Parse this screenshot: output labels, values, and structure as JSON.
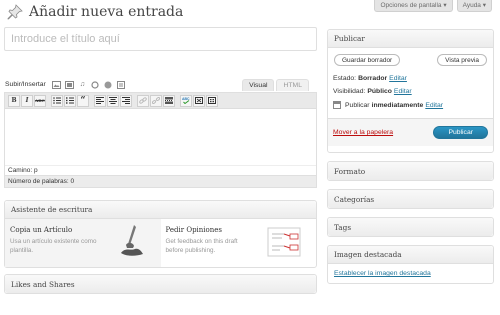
{
  "screen_tabs": {
    "options": "Opciones de pantalla ▾",
    "help": "Ayuda ▾"
  },
  "header": {
    "title": "Añadir nueva entrada"
  },
  "title_field": {
    "placeholder": "Introduce el título aquí"
  },
  "media": {
    "label": "Subir/Insertar"
  },
  "editor_tabs": {
    "visual": "Visual",
    "html": "HTML"
  },
  "toolbar": {
    "bold": "B",
    "italic": "I",
    "strike": "ABC",
    "quote": "“"
  },
  "editor": {
    "path": "Camino: p",
    "word_count": "Número de palabras: 0"
  },
  "writing_helper": {
    "title": "Asistente de escritura",
    "items": [
      {
        "title": "Copia un Artículo",
        "desc": "Usa un artículo existente como plantilla."
      },
      {
        "title": "Pedir Opiniones",
        "desc": "Get feedback on this draft before publishing."
      }
    ]
  },
  "likes_box": {
    "title": "Likes and Shares"
  },
  "publish": {
    "title": "Publicar",
    "save_draft": "Guardar borrador",
    "preview": "Vista previa",
    "status_label": "Estado:",
    "status_value": "Borrador",
    "visibility_label": "Visibilidad:",
    "visibility_value": "Público",
    "schedule_label": "Publicar",
    "schedule_value": "inmediatamente",
    "edit": "Editar",
    "trash": "Mover a la papelera",
    "publish_button": "Publicar"
  },
  "side_boxes": {
    "format": "Formato",
    "categories": "Categorías",
    "tags": "Tags",
    "featured": "Imagen destacada",
    "featured_link": "Establecer la imagen destacada"
  },
  "colors": {
    "link": "#21759b",
    "trash": "#bc0b0b",
    "primary": "#21759b"
  }
}
